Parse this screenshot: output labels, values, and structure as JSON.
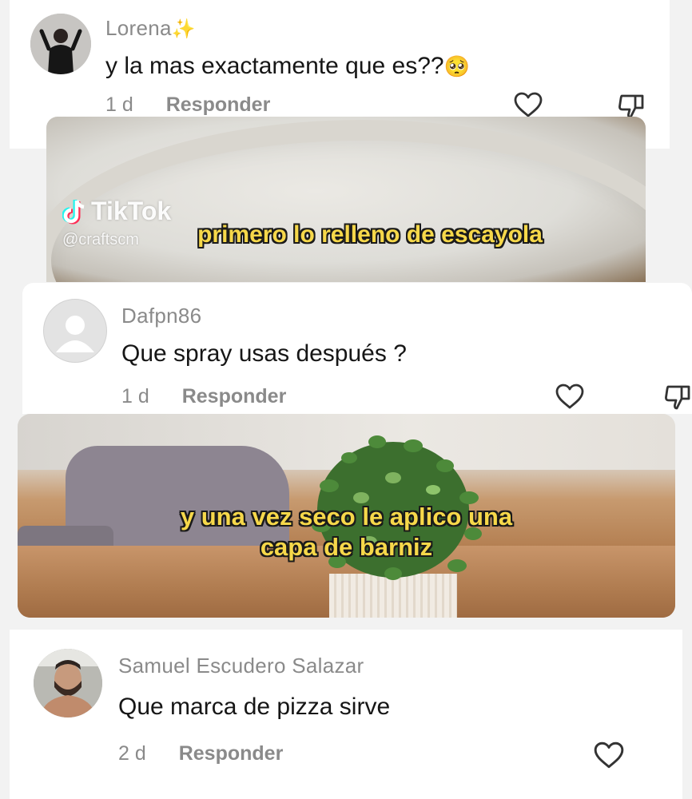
{
  "comments": [
    {
      "username": "Lorena",
      "username_emoji": "✨",
      "text": "y la mas exactamente que es??",
      "text_emoji": "🥺",
      "time": "1 d",
      "reply_label": "Responder"
    },
    {
      "username": "Dafpn86",
      "text": "Que spray usas después ?",
      "time": "1 d",
      "reply_label": "Responder"
    },
    {
      "username": "Samuel Escudero Salazar",
      "text": "Que marca de pizza sirve",
      "time": "2 d",
      "reply_label": "Responder"
    }
  ],
  "videos": [
    {
      "watermark_brand": "TikTok",
      "watermark_handle": "@craftscm",
      "caption_lines": [
        "primero lo relleno de escayola"
      ]
    },
    {
      "caption_lines": [
        "y una vez seco le aplico una",
        "capa de barniz"
      ]
    }
  ],
  "icons": {
    "like": "heart-outline-icon",
    "dislike": "thumbs-down-outline-icon",
    "tiktok_logo": "tiktok-note-icon"
  },
  "colors": {
    "caption": "#f6d84a",
    "username": "#8a8a8a",
    "text": "#161616"
  }
}
